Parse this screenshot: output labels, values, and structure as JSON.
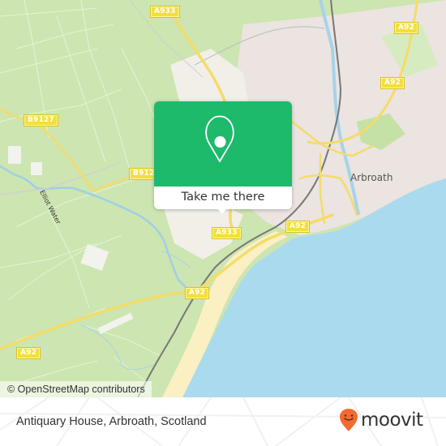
{
  "map": {
    "popup": {
      "icon": "location-pin-icon",
      "cta_label": "Take me there",
      "accent_color": "#1dba6b"
    },
    "road_labels": [
      {
        "id": "a933-north",
        "text": "A933"
      },
      {
        "id": "a92-ne",
        "text": "A92"
      },
      {
        "id": "a92-east",
        "text": "A92"
      },
      {
        "id": "b9127-west",
        "text": "B9127"
      },
      {
        "id": "b9127-mid",
        "text": "B912"
      },
      {
        "id": "a933-south",
        "text": "A933"
      },
      {
        "id": "a92-arbroath",
        "text": "A92"
      },
      {
        "id": "a92-mid",
        "text": "A92"
      },
      {
        "id": "a92-sw",
        "text": "A92"
      }
    ],
    "place_labels": {
      "town": "Arbroath",
      "river": "Elliot Water"
    },
    "attribution": "© OpenStreetMap contributors"
  },
  "footer": {
    "place_title": "Antiquary House, Arbroath, Scotland",
    "brand_name": "moovit",
    "brand_icon": "moovit-smile-pin-icon",
    "brand_color": "#f26a32"
  }
}
